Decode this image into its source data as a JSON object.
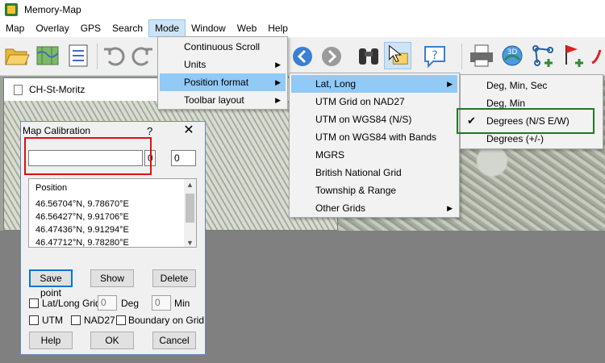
{
  "window": {
    "title": "Memory-Map"
  },
  "menubar": [
    "Map",
    "Overlay",
    "GPS",
    "Search",
    "Mode",
    "Window",
    "Web",
    "Help"
  ],
  "map_window": {
    "title": "CH-St-Moritz"
  },
  "mode_menu": {
    "items": [
      {
        "label": "Continuous Scroll",
        "submenu": false
      },
      {
        "label": "Units",
        "submenu": true
      },
      {
        "label": "Position format",
        "submenu": true
      },
      {
        "label": "Toolbar layout",
        "submenu": true
      }
    ]
  },
  "position_format_menu": {
    "items": [
      {
        "label": "Lat, Long",
        "submenu": true
      },
      {
        "label": "UTM Grid on NAD27",
        "submenu": false
      },
      {
        "label": "UTM on WGS84 (N/S)",
        "submenu": false
      },
      {
        "label": "UTM on WGS84 with Bands",
        "submenu": false
      },
      {
        "label": "MGRS",
        "submenu": false
      },
      {
        "label": "British National Grid",
        "submenu": false
      },
      {
        "label": "Township & Range",
        "submenu": false
      },
      {
        "label": "Other Grids",
        "submenu": true
      }
    ]
  },
  "latlong_menu": {
    "items": [
      {
        "label": "Deg, Min, Sec",
        "checked": false
      },
      {
        "label": "Deg, Min",
        "checked": false
      },
      {
        "label": "Degrees (N/S E/W)",
        "checked": true
      },
      {
        "label": "Degrees (+/-)",
        "checked": false
      }
    ],
    "check_glyph": "✔"
  },
  "dialog": {
    "title": "Map Calibration",
    "help_glyph": "?",
    "close_glyph": "✕",
    "position_value": "",
    "small_value_1": "0",
    "small_value_2": "0",
    "list_header": "Position",
    "list_rows": [
      "46.56704°N,  9.78670°E",
      "46.56427°N,  9.91706°E",
      "46.47436°N,  9.91294°E",
      "46.47712°N,  9.78280°E"
    ],
    "buttons": {
      "save": "Save point",
      "show": "Show",
      "delete": "Delete",
      "help": "Help",
      "ok": "OK",
      "cancel": "Cancel"
    },
    "latlong_grid_label": "Lat/Long Grid",
    "deg_value": "0",
    "deg_label": "Deg",
    "min_value": "0",
    "min_label": "Min",
    "utm_label": "UTM",
    "nad27_label": "NAD27",
    "boundary_label": "Boundary on Grid"
  },
  "colors": {
    "highlight": "#91c9f7",
    "red_annotation": "#e01010",
    "green_annotation": "#1f7a1f"
  }
}
